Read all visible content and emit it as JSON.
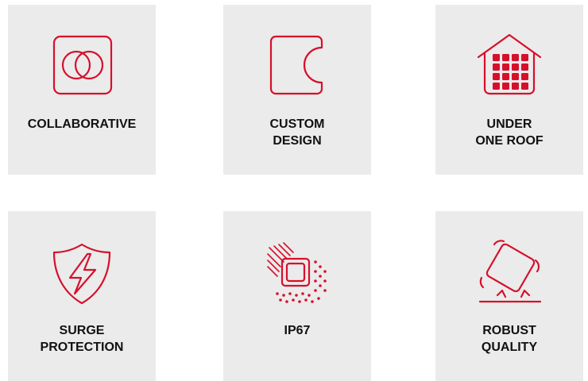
{
  "accent_color": "#d6102b",
  "tiles": [
    {
      "icon": "overlapping-circles-icon",
      "lines": [
        "COLLABORATIVE"
      ]
    },
    {
      "icon": "custom-shape-icon",
      "lines": [
        "CUSTOM",
        "DESIGN"
      ]
    },
    {
      "icon": "house-grid-icon",
      "lines": [
        "UNDER",
        "ONE ROOF"
      ]
    },
    {
      "icon": "shield-lightning-icon",
      "lines": [
        "SURGE",
        "PROTECTION"
      ]
    },
    {
      "icon": "chip-dust-water-icon",
      "lines": [
        "IP67"
      ]
    },
    {
      "icon": "tilted-box-impact-icon",
      "lines": [
        "ROBUST",
        "QUALITY"
      ]
    }
  ]
}
